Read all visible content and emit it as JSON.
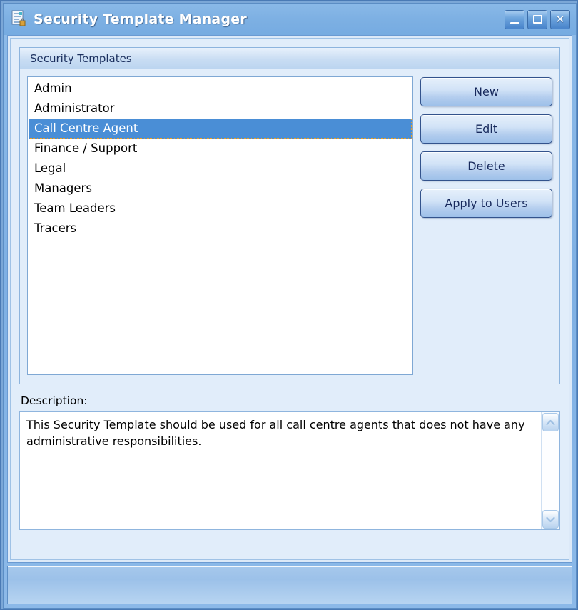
{
  "window": {
    "title": "Security Template Manager",
    "icon": "security-template-icon",
    "controls": [
      {
        "name": "minimize-button",
        "label": "_"
      },
      {
        "name": "maximize-button",
        "label": "❑"
      },
      {
        "name": "close-button",
        "label": "×"
      }
    ]
  },
  "group": {
    "header": "Security Templates"
  },
  "list": {
    "items": [
      {
        "label": "Admin",
        "selected": false
      },
      {
        "label": "Administrator",
        "selected": false
      },
      {
        "label": "Call Centre Agent",
        "selected": true
      },
      {
        "label": "Finance / Support",
        "selected": false
      },
      {
        "label": "Legal",
        "selected": false
      },
      {
        "label": "Managers",
        "selected": false
      },
      {
        "label": "Team Leaders",
        "selected": false
      },
      {
        "label": "Tracers",
        "selected": false
      }
    ]
  },
  "buttons": [
    {
      "name": "new-button",
      "label": "New"
    },
    {
      "name": "edit-button",
      "label": "Edit"
    },
    {
      "name": "delete-button",
      "label": "Delete"
    },
    {
      "name": "apply-to-users-button",
      "label": "Apply to Users"
    }
  ],
  "description": {
    "label": "Description:",
    "value": "This Security Template should be used for all call centre agents that does not have any administrative responsibilities.",
    "scroll_up_icon": "chevron-up-icon",
    "scroll_down_icon": "chevron-down-icon"
  },
  "colors": {
    "titlebar": "#7db0e3",
    "selection": "#4a8ed6",
    "focus_outline": "#f0a020",
    "panel": "#e1edfa",
    "button_text": "#17295c"
  }
}
